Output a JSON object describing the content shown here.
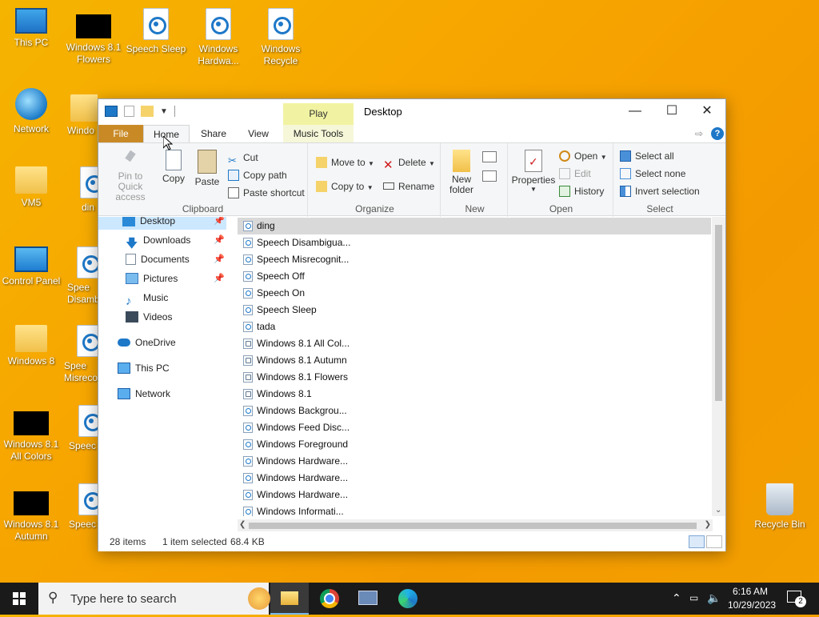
{
  "desktop": {
    "icons": {
      "this_pc": "This PC",
      "win81_flowers": "Windows 8.1 Flowers",
      "speech_sleep": "Speech Sleep",
      "win_hardware": "Windows Hardwa...",
      "win_recycle": "Windows Recycle",
      "network": "Network",
      "window_partial": "Windo",
      "vm5": "VM5",
      "din_partial": "din",
      "control_panel": "Control Panel",
      "spee_disam": "Spee Disamb",
      "windows8": "Windows 8",
      "spee_misrec": "Spee Misreco",
      "win81_allcolors": "Windows 8.1 All Colors",
      "spee3": "Speec",
      "win81_autumn": "Windows 8.1 Autumn",
      "spee4": "Speec",
      "recycle_bin": "Recycle Bin"
    }
  },
  "window": {
    "title": "Desktop",
    "contextual_tab_group": "Play",
    "tabs": [
      "File",
      "Home",
      "Share",
      "View",
      "Music Tools"
    ],
    "ribbon": {
      "clipboard": {
        "label": "Clipboard",
        "pin_to_quick_access": "Pin to Quick access",
        "copy": "Copy",
        "paste": "Paste",
        "cut": "Cut",
        "copy_path": "Copy path",
        "paste_shortcut": "Paste shortcut"
      },
      "organize": {
        "label": "Organize",
        "move_to": "Move to",
        "copy_to": "Copy to",
        "delete": "Delete",
        "rename": "Rename"
      },
      "new": {
        "label": "New",
        "new_folder": "New folder"
      },
      "open": {
        "label": "Open",
        "properties": "Properties",
        "open": "Open",
        "edit": "Edit",
        "history": "History"
      },
      "select": {
        "label": "Select",
        "select_all": "Select all",
        "select_none": "Select none",
        "invert_selection": "Invert selection"
      }
    },
    "nav": {
      "items": [
        {
          "label": "Desktop",
          "pinned": true
        },
        {
          "label": "Downloads",
          "pinned": true
        },
        {
          "label": "Documents",
          "pinned": true
        },
        {
          "label": "Pictures",
          "pinned": true
        },
        {
          "label": "Music",
          "pinned": false
        },
        {
          "label": "Videos",
          "pinned": false
        },
        {
          "label": "OneDrive",
          "pinned": false
        },
        {
          "label": "This PC",
          "pinned": false
        },
        {
          "label": "Network",
          "pinned": false
        }
      ]
    },
    "files": [
      {
        "name": "ding",
        "selected": true
      },
      {
        "name": "Speech Disambigua..."
      },
      {
        "name": "Speech Misrecognit..."
      },
      {
        "name": "Speech Off"
      },
      {
        "name": "Speech On"
      },
      {
        "name": "Speech Sleep"
      },
      {
        "name": "tada"
      },
      {
        "name": "Windows 8.1 All Col..."
      },
      {
        "name": "Windows 8.1 Autumn"
      },
      {
        "name": "Windows 8.1 Flowers"
      },
      {
        "name": "Windows 8.1"
      },
      {
        "name": "Windows Backgrou..."
      },
      {
        "name": "Windows Feed Disc..."
      },
      {
        "name": "Windows Foreground"
      },
      {
        "name": "Windows Hardware..."
      },
      {
        "name": "Windows Hardware..."
      },
      {
        "name": "Windows Hardware..."
      },
      {
        "name": "Windows Informati..."
      }
    ],
    "status": {
      "items_count": "28 items",
      "selected": "1 item selected",
      "size": "68.4 KB"
    }
  },
  "taskbar": {
    "search_placeholder": "Type here to search",
    "time": "6:16 AM",
    "date": "10/29/2023",
    "notification_count": "2"
  },
  "colors": {
    "file_tab": "#c98a26",
    "context_tab": "#f1f3a2",
    "selection": "#d9d9d9",
    "accent": "#1e78c8"
  }
}
